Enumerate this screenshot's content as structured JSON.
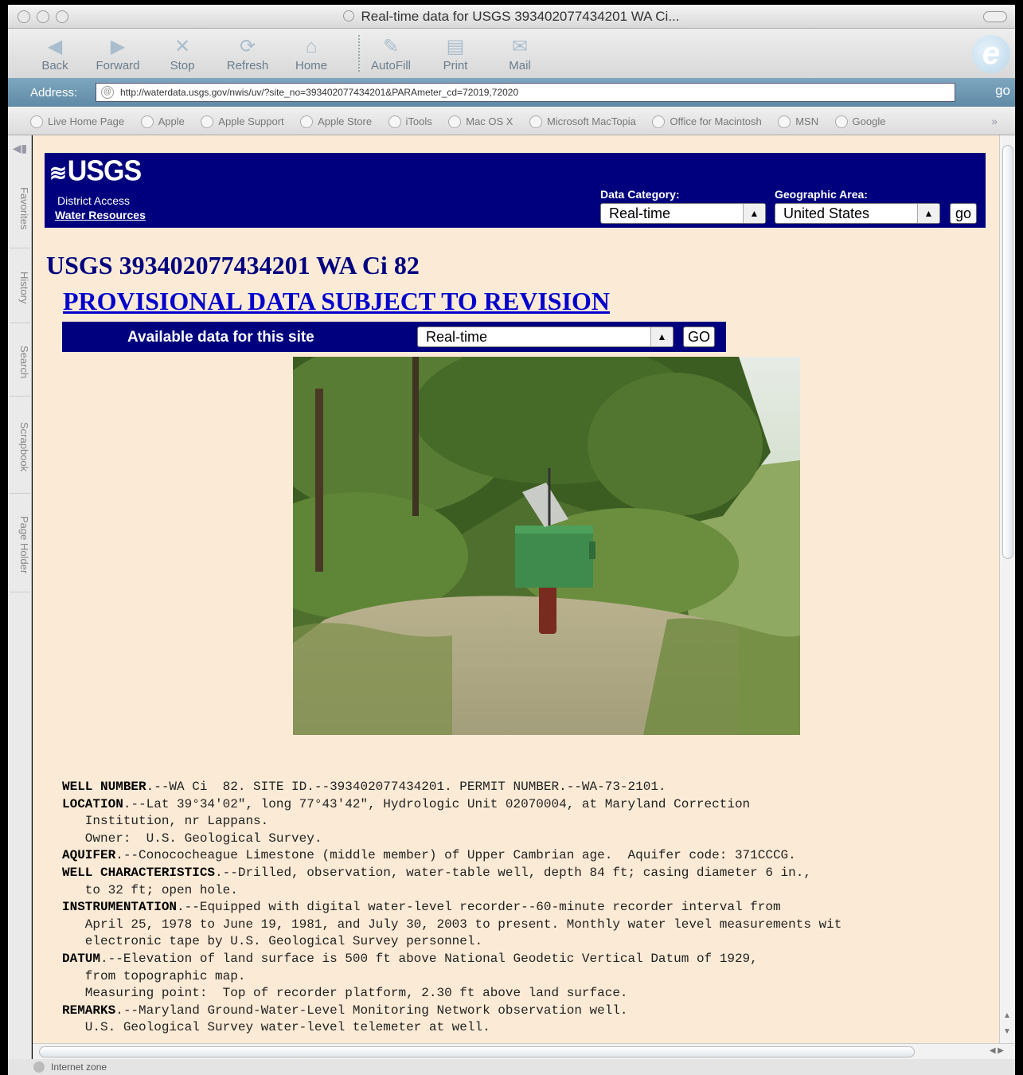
{
  "window": {
    "title": "Real-time data for USGS 393402077434201 WA Ci..."
  },
  "toolbar": {
    "buttons": [
      "Back",
      "Forward",
      "Stop",
      "Refresh",
      "Home",
      "AutoFill",
      "Print",
      "Mail"
    ]
  },
  "address": {
    "label": "Address:",
    "url": "http://waterdata.usgs.gov/nwis/uv/?site_no=393402077434201&PARAmeter_cd=72019,72020",
    "go": "go"
  },
  "favorites": [
    "Live Home Page",
    "Apple",
    "Apple Support",
    "Apple Store",
    "iTools",
    "Mac OS X",
    "Microsoft MacTopia",
    "Office for Macintosh",
    "MSN",
    "Google"
  ],
  "side_tabs": [
    "Favorites",
    "History",
    "Search",
    "Scrapbook",
    "Page Holder"
  ],
  "status": {
    "text": "Internet zone"
  },
  "usgs": {
    "logo": "USGS",
    "district": "District Access",
    "water_resources": "Water Resources",
    "data_category_label": "Data Category:",
    "data_category_value": "Real-time",
    "geo_area_label": "Geographic Area:",
    "geo_area_value": "United States",
    "go": "go"
  },
  "page": {
    "site_title": "USGS 393402077434201 WA Ci 82",
    "provisional": "PROVISIONAL DATA SUBJECT TO REVISION",
    "available_label": "Available data for this site",
    "available_value": "Real-time",
    "available_go": "GO"
  },
  "description": {
    "well_number_key": "WELL NUMBER",
    "well_number_text": ".--WA Ci  82. SITE ID.--393402077434201. PERMIT NUMBER.--WA-73-2101.",
    "location_key": "LOCATION",
    "location_text": ".--Lat 39°34'02\", long 77°43'42\", Hydrologic Unit 02070004, at Maryland Correction",
    "location_line2": "   Institution, nr Lappans.",
    "owner_line": "   Owner:  U.S. Geological Survey.",
    "aquifer_key": "AQUIFER",
    "aquifer_text": ".--Conococheague Limestone (middle member) of Upper Cambrian age.  Aquifer code: 371CCCG.",
    "wellchar_key": "WELL CHARACTERISTICS",
    "wellchar_text": ".--Drilled, observation, water-table well, depth 84 ft; casing diameter 6 in.,",
    "wellchar_line2": "   to 32 ft; open hole.",
    "instr_key": "INSTRUMENTATION",
    "instr_text": ".--Equipped with digital water-level recorder--60-minute recorder interval from",
    "instr_line2": "   April 25, 1978 to June 19, 1981, and July 30, 2003 to present. Monthly water level measurements wit",
    "instr_line3": "   electronic tape by U.S. Geological Survey personnel.",
    "datum_key": "DATUM",
    "datum_text": ".--Elevation of land surface is 500 ft above National Geodetic Vertical Datum of 1929,",
    "datum_line2": "   from topographic map.",
    "datum_line3": "   Measuring point:  Top of recorder platform, 2.30 ft above land surface.",
    "remarks_key": "REMARKS",
    "remarks_text": ".--Maryland Ground-Water-Level Monitoring Network observation well.",
    "remarks_line2": "   U.S. Geological Survey water-level telemeter at well."
  }
}
